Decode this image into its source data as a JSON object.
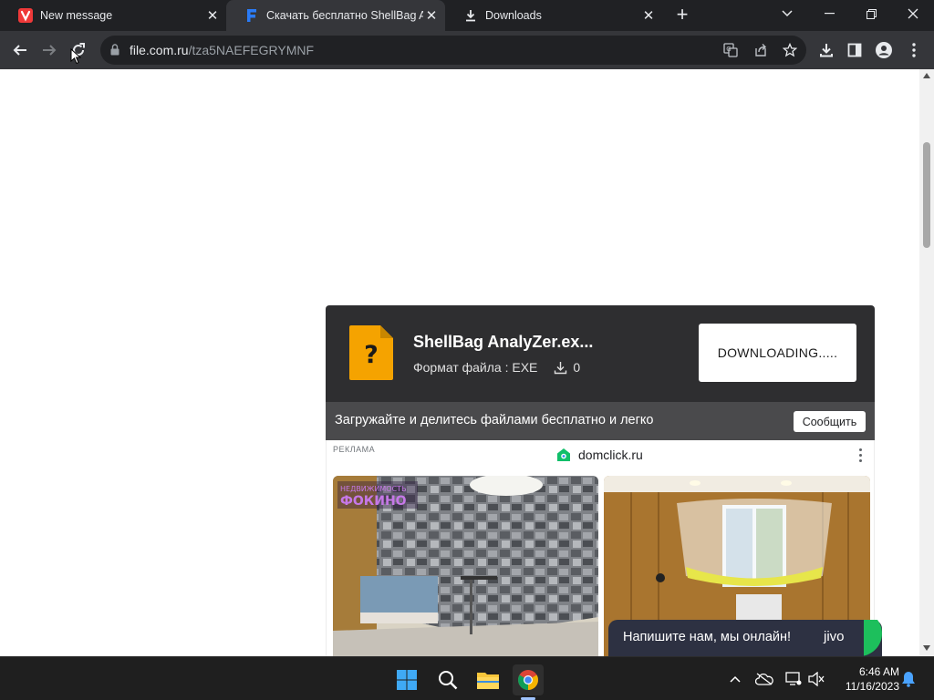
{
  "tabs": [
    {
      "title": "New message",
      "icon": "vivaldi-mail-icon",
      "active": false
    },
    {
      "title": "Скачать бесплатно ShellBag An",
      "icon": "file-site-favicon",
      "active": true
    },
    {
      "title": "Downloads",
      "icon": "download-icon",
      "active": false
    }
  ],
  "new_tab_label": "+",
  "address": {
    "host": "file.com.ru",
    "path": "/tza5NAEFEGRYMNF"
  },
  "download": {
    "file_name": "ShellBag AnalyZer.ex...",
    "format_label": "Формат файла : EXE",
    "download_count": "0",
    "button_label": "DOWNLOADING....."
  },
  "share_bar": {
    "text": "Загружайте и делитесь файлами бесплатно и легко",
    "report_label": "Сообщить"
  },
  "ad": {
    "label": "РЕКЛАМА",
    "source": "domclick.ru",
    "photo_1_caption": "ФОКИНО",
    "photo_1_top_text": "НЕДВИЖИМОСТЬ"
  },
  "chat": {
    "text": "Напишите нам, мы онлайн!",
    "brand": "jivo"
  },
  "taskbar": {
    "time": "6:46 AM",
    "date": "11/16/2023"
  },
  "colors": {
    "browser_frame": "#202124",
    "toolbar": "#35363a",
    "download_card": "#2e2e30",
    "share_bar": "#4a4a4c",
    "file_icon": "#f5a300",
    "chat_widget": "#2d3142",
    "chat_accent": "#1dbf5c"
  }
}
